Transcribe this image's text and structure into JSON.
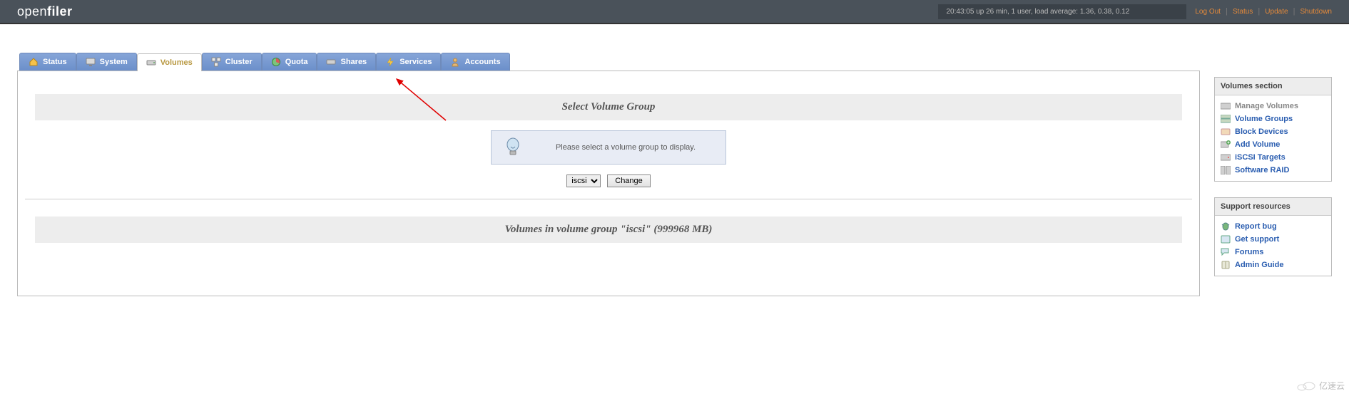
{
  "brand": {
    "part1": "open",
    "part2": "filer"
  },
  "system_status": "20:43:05 up 26 min, 1 user, load average: 1.36, 0.38, 0.12",
  "top_links": {
    "logout": "Log Out",
    "status": "Status",
    "update": "Update",
    "shutdown": "Shutdown"
  },
  "tabs": {
    "status": "Status",
    "system": "System",
    "volumes": "Volumes",
    "cluster": "Cluster",
    "quota": "Quota",
    "shares": "Shares",
    "services": "Services",
    "accounts": "Accounts"
  },
  "main": {
    "select_heading": "Select Volume Group",
    "info_message": "Please select a volume group to display.",
    "select_value": "iscsi",
    "change_button": "Change",
    "volumes_heading": "Volumes in volume group \"iscsi\" (999968 MB)"
  },
  "sidebar": {
    "volumes_section": {
      "title": "Volumes section",
      "items": [
        {
          "label": "Manage Volumes",
          "muted": true
        },
        {
          "label": "Volume Groups",
          "muted": false
        },
        {
          "label": "Block Devices",
          "muted": false
        },
        {
          "label": "Add Volume",
          "muted": false
        },
        {
          "label": "iSCSI Targets",
          "muted": false
        },
        {
          "label": "Software RAID",
          "muted": false
        }
      ]
    },
    "support_section": {
      "title": "Support resources",
      "items": [
        {
          "label": "Report bug"
        },
        {
          "label": "Get support"
        },
        {
          "label": "Forums"
        },
        {
          "label": "Admin Guide"
        }
      ]
    }
  },
  "watermark": "亿速云"
}
